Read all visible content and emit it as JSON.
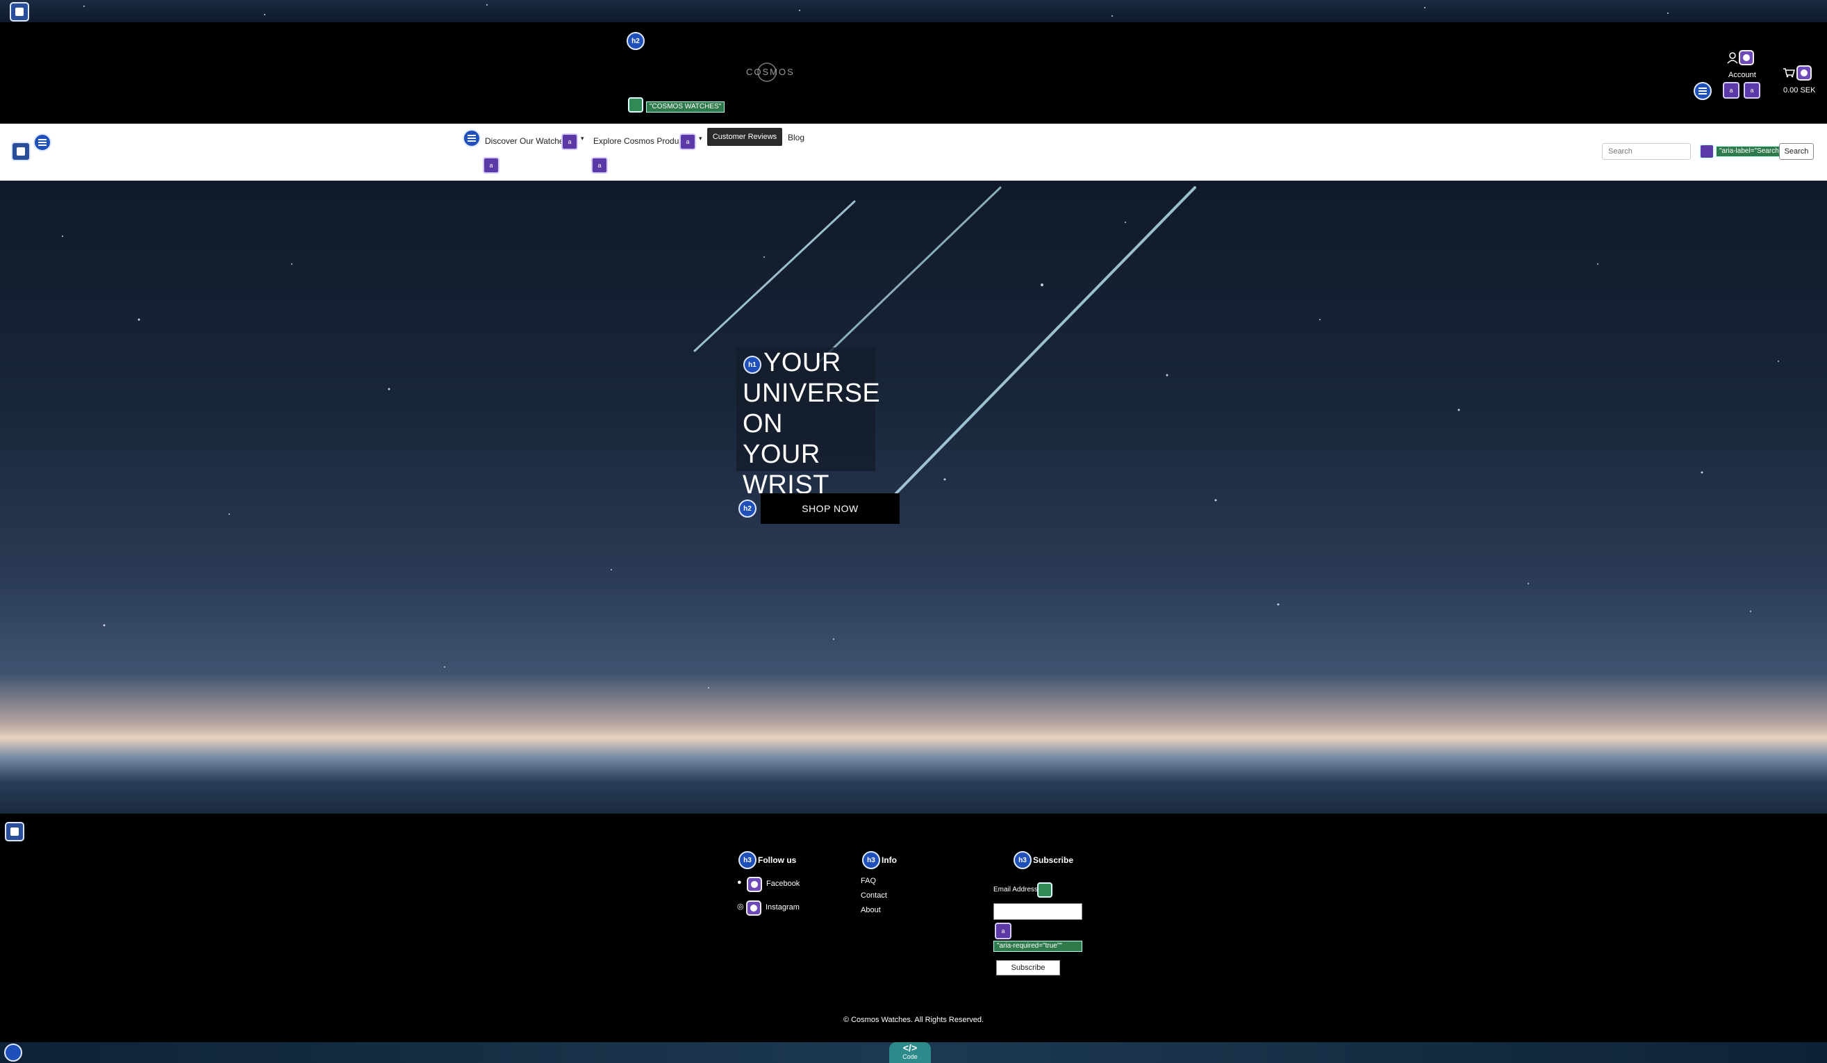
{
  "header": {
    "logo_text": "COSMOS",
    "brand_aria_badge": "\"COSMOS WATCHES\"",
    "account_label": "Account",
    "cart_total": "0.00 SEK"
  },
  "nav": {
    "items": [
      {
        "label": "Discover Our Watches"
      },
      {
        "label": "Explore Cosmos Products"
      },
      {
        "label": "Customer Reviews"
      },
      {
        "label": "Blog"
      }
    ],
    "search_placeholder": "Search",
    "search_aria_badge": "\"aria-label=\"Search\"\"",
    "search_button": "Search"
  },
  "hero": {
    "title": "YOUR UNIVERSE ON YOUR WRIST",
    "cta": "SHOP NOW"
  },
  "footer": {
    "follow": {
      "heading": "Follow us",
      "links": [
        "Facebook",
        "Instagram"
      ]
    },
    "info": {
      "heading": "Info",
      "links": [
        "FAQ",
        "Contact",
        "About"
      ]
    },
    "subscribe": {
      "heading": "Subscribe",
      "email_label": "Email Address",
      "required_badge": "\"aria-required=\"true\"\"",
      "button": "Subscribe"
    },
    "copyright": "© Cosmos Watches. All Rights Reserved."
  },
  "overlay": {
    "heading_badges": {
      "h1": "h1",
      "h2": "h2",
      "h3": "h3"
    },
    "code_tab": "Code",
    "code_glyph": "</>"
  },
  "colors": {
    "header_bg": "#000000",
    "nav_bg": "#ffffff",
    "badge_blue": "#1f4fb8",
    "badge_purple": "#5b3aa8",
    "badge_green": "#2f7a4a"
  }
}
